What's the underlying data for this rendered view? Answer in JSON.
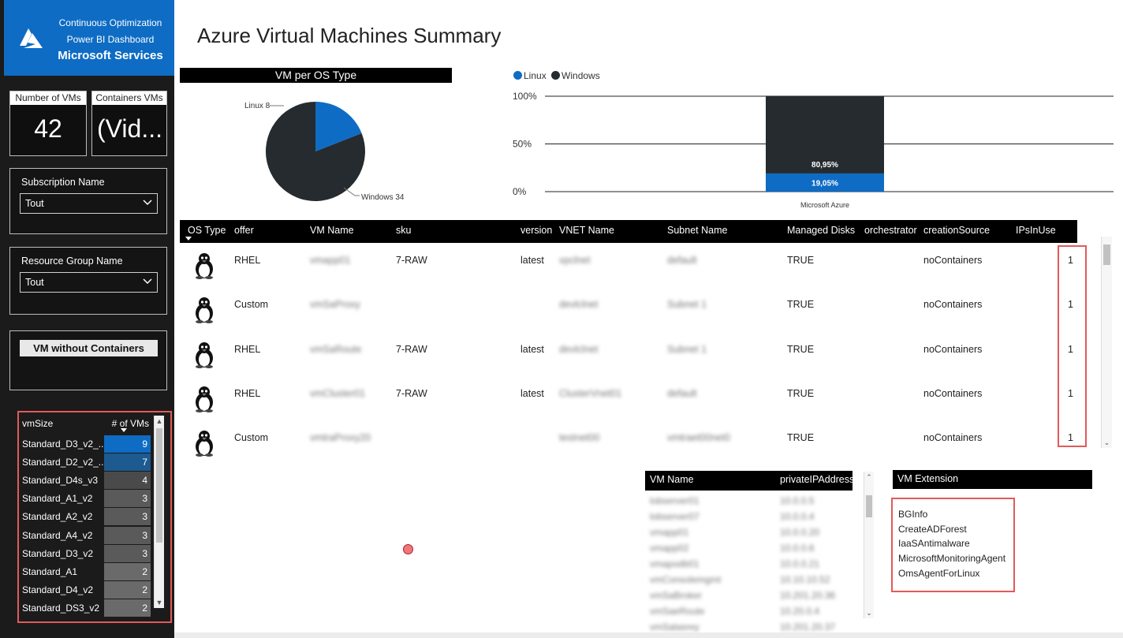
{
  "brand": {
    "line1": "Continuous Optimization",
    "line2": "Power BI Dashboard",
    "line3": "Microsoft Services"
  },
  "cards": {
    "vms_label": "Number of VMs",
    "vms_value": "42",
    "containers_label": "Containers VMs",
    "containers_value": "(Vid..."
  },
  "filters": {
    "subscription": {
      "label": "Subscription Name",
      "value": "Tout"
    },
    "resource_group": {
      "label": "Resource Group Name",
      "value": "Tout"
    },
    "no_containers_button": "VM without Containers"
  },
  "vmsize": {
    "col_name": "vmSize",
    "col_count": "# of VMs",
    "rows": [
      {
        "name": "Standard_D3_v2_...",
        "count": "9",
        "color": "#0e6cc4"
      },
      {
        "name": "Standard_D2_v2_...",
        "count": "7",
        "color": "#1d5a8f"
      },
      {
        "name": "Standard_D4s_v3",
        "count": "4",
        "color": "#4a4a4a"
      },
      {
        "name": "Standard_A1_v2",
        "count": "3",
        "color": "#5a5a5a"
      },
      {
        "name": "Standard_A2_v2",
        "count": "3",
        "color": "#5a5a5a"
      },
      {
        "name": "Standard_A4_v2",
        "count": "3",
        "color": "#5a5a5a"
      },
      {
        "name": "Standard_D3_v2",
        "count": "3",
        "color": "#5a5a5a"
      },
      {
        "name": "Standard_A1",
        "count": "2",
        "color": "#6a6a6a"
      },
      {
        "name": "Standard_D4_v2",
        "count": "2",
        "color": "#6a6a6a"
      },
      {
        "name": "Standard_DS3_v2",
        "count": "2",
        "color": "#6a6a6a"
      }
    ]
  },
  "page": {
    "title": "Azure Virtual Machines Summary"
  },
  "pie": {
    "title": "VM per OS Type",
    "label_linux": "Linux 8",
    "label_windows": "Windows 34"
  },
  "stacked": {
    "legend_linux": "Linux",
    "legend_windows": "Windows",
    "category_label": "Microsoft Azure",
    "label_windows": "80,95%",
    "label_linux": "19,05%",
    "ticks": [
      "100%",
      "50%",
      "0%"
    ]
  },
  "chart_data": [
    {
      "type": "pie",
      "title": "VM per OS Type",
      "categories": [
        "Linux",
        "Windows"
      ],
      "values": [
        8,
        34
      ],
      "colors": [
        "#0e6cc4",
        "#252b2e"
      ]
    },
    {
      "type": "bar",
      "stacked": true,
      "categories": [
        "Microsoft Azure"
      ],
      "series": [
        {
          "name": "Linux",
          "values": [
            19.05
          ],
          "color": "#0e6cc4"
        },
        {
          "name": "Windows",
          "values": [
            80.95
          ],
          "color": "#252b2e"
        }
      ],
      "ylim": [
        0,
        100
      ],
      "yticks": [
        "0%",
        "50%",
        "100%"
      ],
      "legend": "top-left"
    }
  ],
  "vm_table": {
    "headers": [
      "OS Type",
      "offer",
      "VM Name",
      "sku",
      "version",
      "VNET Name",
      "Subnet Name",
      "Managed Disks",
      "orchestrator",
      "creationSource",
      "IPsInUse"
    ],
    "rows": [
      {
        "offer": "RHEL",
        "vm": "vmapp01",
        "sku": "7-RAW",
        "version": "latest",
        "vnet": "vpclnet",
        "subnet": "default",
        "disks": "TRUE",
        "orch": "",
        "source": "noContainers",
        "ips": "1"
      },
      {
        "offer": "Custom",
        "vm": "vmSaProxy",
        "sku": "",
        "version": "",
        "vnet": "devlclnet",
        "subnet": "Subnet 1",
        "disks": "TRUE",
        "orch": "",
        "source": "noContainers",
        "ips": "1"
      },
      {
        "offer": "RHEL",
        "vm": "vmSaRoute",
        "sku": "7-RAW",
        "version": "latest",
        "vnet": "devlclnet",
        "subnet": "Subnet 1",
        "disks": "TRUE",
        "orch": "",
        "source": "noContainers",
        "ips": "1"
      },
      {
        "offer": "RHEL",
        "vm": "vmCluster01",
        "sku": "7-RAW",
        "version": "latest",
        "vnet": "ClusterVnet01",
        "subnet": "default",
        "disks": "TRUE",
        "orch": "",
        "source": "noContainers",
        "ips": "1"
      },
      {
        "offer": "Custom",
        "vm": "vmtraProxy20",
        "sku": "",
        "version": "",
        "vnet": "testnet00",
        "subnet": "vmtraet00net0",
        "disks": "TRUE",
        "orch": "",
        "source": "noContainers",
        "ips": "1"
      }
    ]
  },
  "ip_table": {
    "headers": [
      "VM Name",
      "privateIPAddress"
    ],
    "rows": [
      {
        "name": "lobserver01",
        "ip": "10.0.0.5"
      },
      {
        "name": "lobserver07",
        "ip": "10.0.0.4"
      },
      {
        "name": "vmapp01",
        "ip": "10.0.0.20"
      },
      {
        "name": "vmapp02",
        "ip": "10.0.0.6"
      },
      {
        "name": "vmapodb01",
        "ip": "10.0.0.21"
      },
      {
        "name": "vmConsolemgmt",
        "ip": "10.10.10.52"
      },
      {
        "name": "vmSaBroker",
        "ip": "10.201.20.36"
      },
      {
        "name": "vmSaeRoute",
        "ip": "10.20.0.4"
      },
      {
        "name": "vmSalasrey",
        "ip": "10.201.20.37"
      }
    ]
  },
  "extensions": {
    "title": "VM Extension",
    "items": [
      "BGInfo",
      "CreateADForest",
      "IaaSAntimalware",
      "MicrosoftMonitoringAgent",
      "OmsAgentForLinux"
    ]
  }
}
